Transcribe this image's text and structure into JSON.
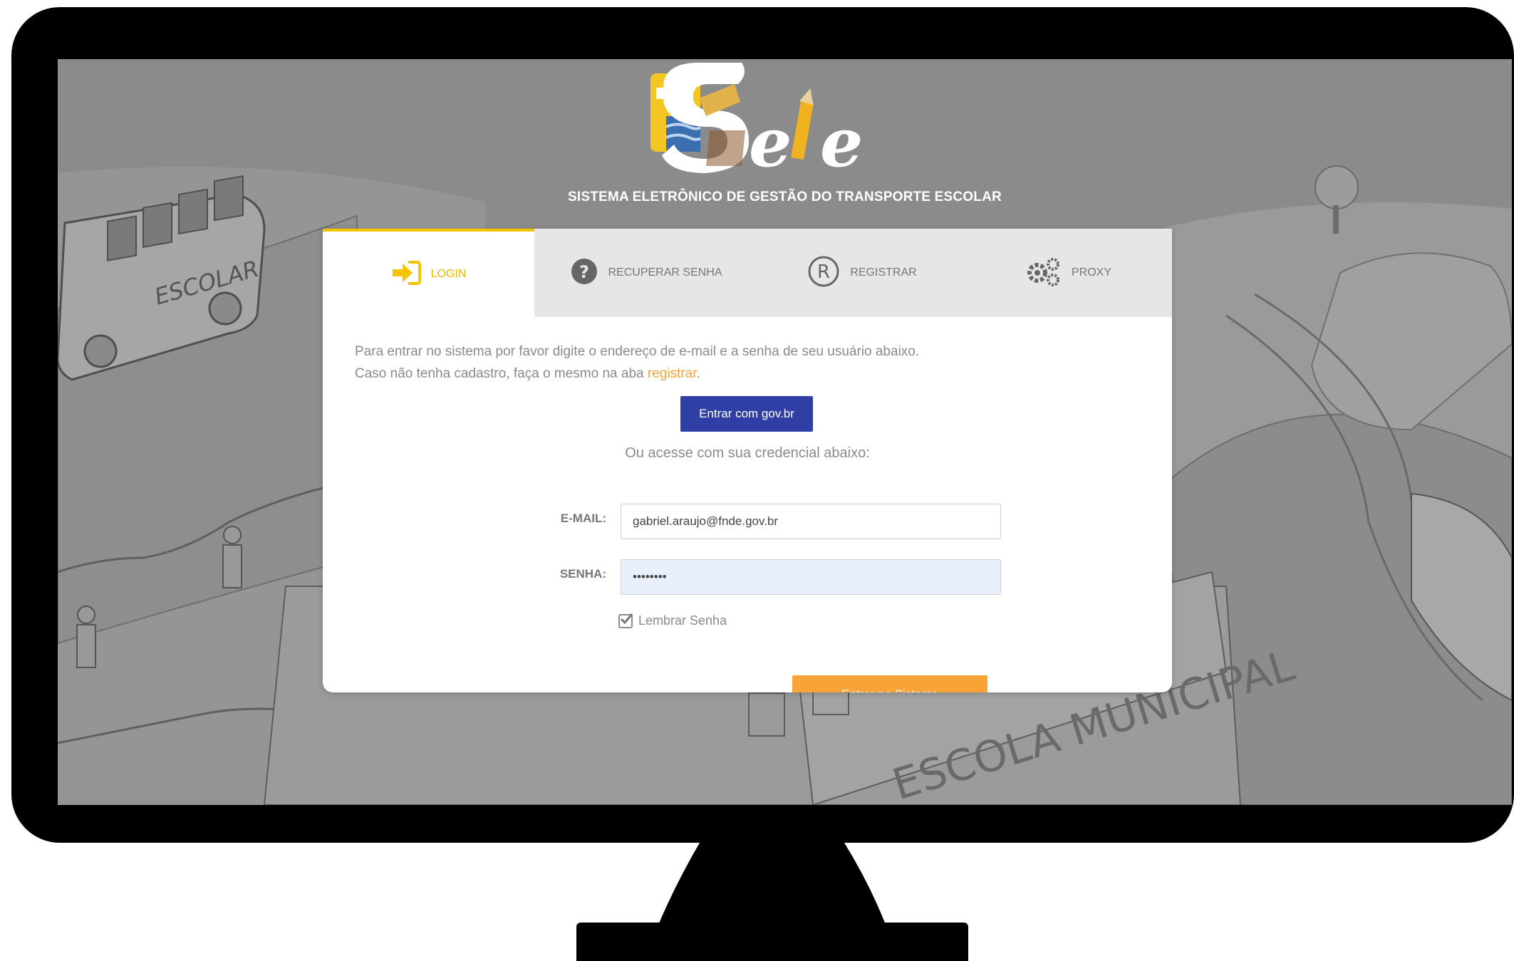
{
  "app": {
    "logo_text": "Sete",
    "subtitle": "SISTEMA ELETRÔNICO DE GESTÃO DO TRANSPORTE ESCOLAR"
  },
  "tabs": [
    {
      "label": "LOGIN",
      "icon": "login-icon",
      "active": true
    },
    {
      "label": "RECUPERAR SENHA",
      "icon": "question-icon",
      "active": false
    },
    {
      "label": "REGISTRAR",
      "icon": "registered-icon",
      "active": false
    },
    {
      "label": "PROXY",
      "icon": "gears-icon",
      "active": false
    }
  ],
  "login": {
    "intro_line1": "Para entrar no sistema por favor digite o endereço de e-mail e a senha de seu usuário abaixo.",
    "intro_line2_prefix": "Caso não tenha cadastro, faça o mesmo na aba ",
    "intro_link": "registrar",
    "intro_line2_suffix": ".",
    "govbr_button": "Entrar com gov.br",
    "alt_text": "Ou acesse com sua credencial abaixo:",
    "email_label": "E-MAIL:",
    "email_value": "gabriel.araujo@fnde.gov.br",
    "password_label": "SENHA:",
    "password_value": "••••••••",
    "remember_label": "Lembrar Senha",
    "remember_checked": true,
    "submit_button": "Entrar no Sistema"
  },
  "background_texts": {
    "bus_label": "ESCOLAR",
    "school_label": "ESCOLA MUNICIPAL"
  },
  "colors": {
    "accent_yellow": "#f5c400",
    "govbr_blue": "#2f3fa6",
    "submit_orange": "#f7a337",
    "link_orange": "#f6a23a"
  }
}
